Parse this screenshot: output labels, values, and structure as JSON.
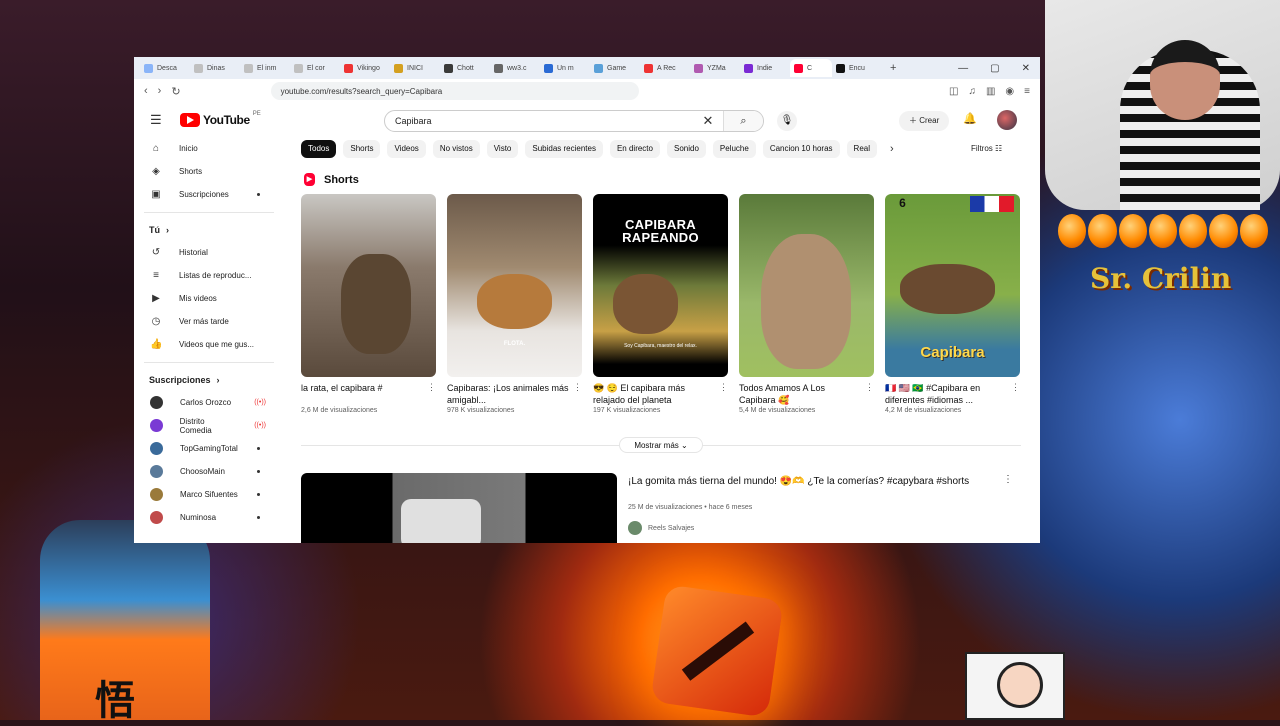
{
  "browser": {
    "tabs": [
      {
        "label": "Desca",
        "color": "#8ab4f8"
      },
      {
        "label": "Dinas",
        "color": "#c0c0c0"
      },
      {
        "label": "El inm",
        "color": "#c0c0c0"
      },
      {
        "label": "El cor",
        "color": "#c0c0c0"
      },
      {
        "label": "Vikingo",
        "color": "#e33"
      },
      {
        "label": "INICI",
        "color": "#d4a020"
      },
      {
        "label": "Chott",
        "color": "#3a3a3a"
      },
      {
        "label": "ww3.c",
        "color": "#666"
      },
      {
        "label": "Un m",
        "color": "#2a6ad4"
      },
      {
        "label": "Game",
        "color": "#5aa0d8"
      },
      {
        "label": "A Rec",
        "color": "#e33"
      },
      {
        "label": "YZMa",
        "color": "#b05ab0"
      },
      {
        "label": "Indie",
        "color": "#7a2ad4"
      },
      {
        "label": "C",
        "color": "#ff0033"
      },
      {
        "label": "Encu",
        "color": "#111"
      }
    ],
    "url": "youtube.com/results?search_query=Capibara"
  },
  "youtube": {
    "logo_text": "YouTube",
    "region": "PE",
    "search_value": "Capibara",
    "create_label": "Crear"
  },
  "sidebar": {
    "main": [
      {
        "label": "Inicio",
        "icon": "home-icon",
        "glyph": "⌂"
      },
      {
        "label": "Shorts",
        "icon": "shorts-icon",
        "glyph": "◈"
      },
      {
        "label": "Suscripciones",
        "icon": "subscriptions-icon",
        "glyph": "▣"
      }
    ],
    "you_label": "Tú",
    "you_items": [
      {
        "label": "Historial",
        "glyph": "↺"
      },
      {
        "label": "Listas de reproduc...",
        "glyph": "≡"
      },
      {
        "label": "Mis videos",
        "glyph": "▶"
      },
      {
        "label": "Ver más tarde",
        "glyph": "◷"
      },
      {
        "label": "Videos que me gus...",
        "glyph": "👍"
      }
    ],
    "subs_label": "Suscripciones",
    "subs": [
      {
        "label": "Carlos Orozco",
        "avatar": "#333",
        "live": true
      },
      {
        "label": "Distrito Comedia",
        "avatar": "#7a3ad4",
        "live": true
      },
      {
        "label": "TopGamingTotal",
        "avatar": "#3a6a9a",
        "live": false
      },
      {
        "label": "ChoosoMain",
        "avatar": "#5a7a9a",
        "live": false
      },
      {
        "label": "Marco Sifuentes",
        "avatar": "#9a7a3a",
        "live": false
      },
      {
        "label": "Numinosa",
        "avatar": "#c04a4a",
        "live": false
      }
    ]
  },
  "chips": [
    "Todos",
    "Shorts",
    "Videos",
    "No vistos",
    "Visto",
    "Subidas recientes",
    "En directo",
    "Sonido",
    "Peluche",
    "Cancion 10 horas",
    "Real"
  ],
  "filters_label": "Filtros",
  "shorts": {
    "heading": "Shorts",
    "items": [
      {
        "title": "la rata, el capibara #",
        "views": "2,6 M de visualizaciones"
      },
      {
        "title": "Capibaras: ¡Los animales más amigabl...",
        "views": "978 K visualizaciones"
      },
      {
        "title": "😎 😌 El capibara más relajado del planeta",
        "views": "197 K visualizaciones"
      },
      {
        "title": "Todos Amamos A Los Capibara 🥰",
        "views": "5,4 M de visualizaciones"
      },
      {
        "title": "🇫🇷 🇺🇸 🇧🇷 #Capibara en diferentes #idiomas ...",
        "views": "4,2 M de visualizaciones"
      }
    ],
    "overlay_t2": "FLOTA.",
    "overlay_t3": "CAPIBARA RAPEANDO",
    "overlay_t3_sub": "Soy Capibara, maestro del relax.",
    "overlay_t5": "Capibara",
    "overlay_t5_num": "6"
  },
  "show_more": "Mostrar más ⌄",
  "video": {
    "title": "¡La gomita más tierna del mundo! 😍🫶 ¿Te la comerías? #capybara #shorts",
    "meta": "25 M de visualizaciones • hace 6 meses",
    "channel": "Reels Salvajes"
  },
  "overlay": {
    "brand": "Sr. Crilin",
    "mascot_char": "悟"
  }
}
